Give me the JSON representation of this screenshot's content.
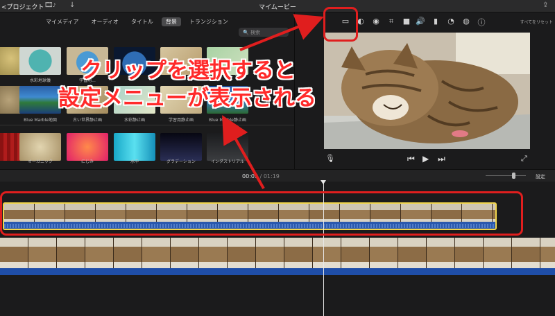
{
  "titlebar": {
    "back_label": "プロジェクト",
    "title": "マイムービー"
  },
  "browser": {
    "tabs": [
      {
        "label": "マイメディア",
        "active": false
      },
      {
        "label": "オーディオ",
        "active": false
      },
      {
        "label": "タイトル",
        "active": false
      },
      {
        "label": "背景",
        "active": true
      },
      {
        "label": "トランジション",
        "active": false
      }
    ],
    "search_placeholder": "検索",
    "row1_labels": [
      "",
      "水彩地球儀",
      "学習用...",
      "",
      "",
      ""
    ],
    "row2_labels": [
      "",
      "Blue Marble地図",
      "古い世界静止画",
      "水彩静止画",
      "学習用静止画",
      "Blue Marble静止画"
    ],
    "row3_labels": [
      "",
      "オーガニック",
      "にじみ",
      "水中",
      "グラデーション",
      "インダストリアル"
    ]
  },
  "viewer": {
    "reset_label": "すべてをリセット",
    "tools": [
      "crop-to-fill-icon",
      "color-balance-icon",
      "color-palette-icon",
      "crop-icon",
      "camera-icon",
      "volume-icon",
      "equalizer-icon",
      "speed-icon",
      "noise-reduction-icon",
      "filter-icon",
      "info-icon"
    ]
  },
  "timeline": {
    "current_time": "00:09",
    "separator": " / ",
    "duration": "01:19",
    "settings_label": "設定",
    "playhead_position": 0.118
  },
  "annotation": {
    "line1": "クリップを選択すると",
    "line2": "設定メニューが表示される"
  },
  "colors": {
    "annotation_red": "#e01e1e",
    "clip_selection": "#f1d54b",
    "audio_blue": "#2456a8"
  }
}
